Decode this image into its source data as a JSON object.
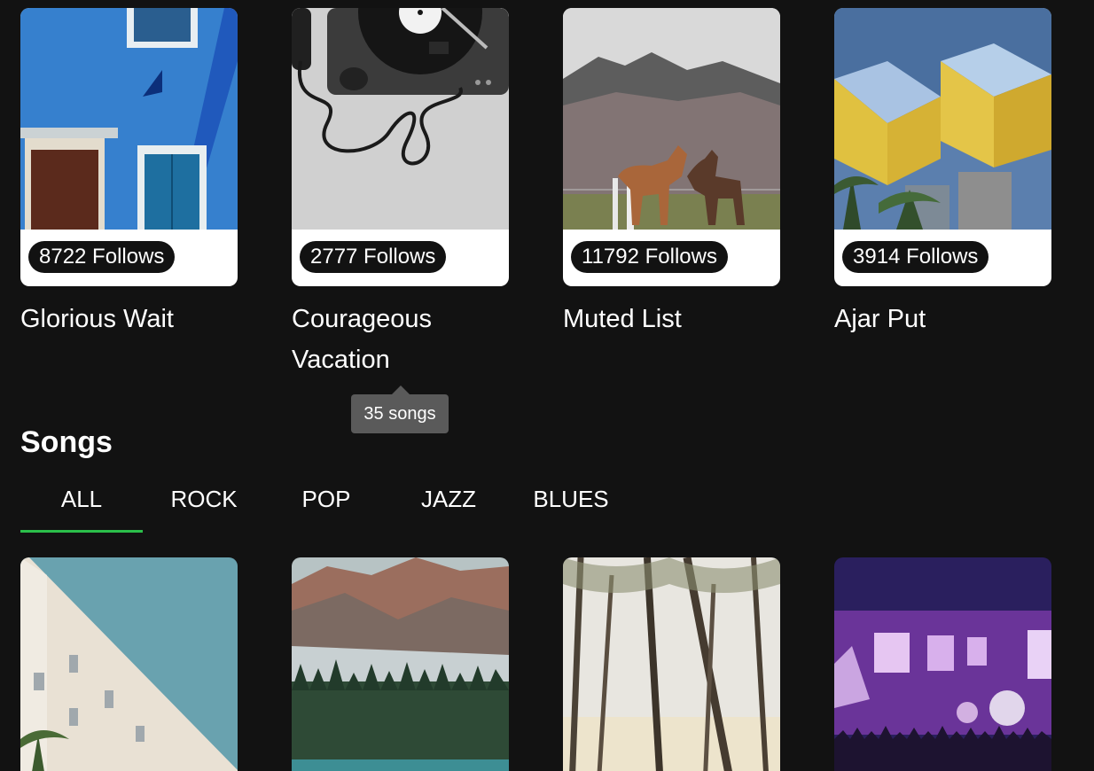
{
  "playlists": [
    {
      "title": "Glorious Wait",
      "follows": "8722 Follows",
      "image": "blue-wall-photo"
    },
    {
      "title": "Courageous Vacation",
      "follows": "2777 Follows",
      "image": "turntable-photo"
    },
    {
      "title": "Muted List",
      "follows": "11792 Follows",
      "image": "horses-photo"
    },
    {
      "title": "Ajar Put",
      "follows": "3914 Follows",
      "image": "cube-houses-photo"
    }
  ],
  "tooltip": {
    "text": "35 songs"
  },
  "songs_section": {
    "heading": "Songs",
    "tabs": [
      "ALL",
      "ROCK",
      "POP",
      "JAZZ",
      "BLUES"
    ],
    "active_tab": "ALL"
  },
  "song_cards": [
    {
      "image": "white-building-photo"
    },
    {
      "image": "mountain-lake-photo"
    },
    {
      "image": "forest-trees-photo"
    },
    {
      "image": "concert-crowd-photo"
    }
  ],
  "colors": {
    "background": "#121212",
    "accent": "#2bbf4a",
    "tooltip": "#5a5a5a"
  }
}
